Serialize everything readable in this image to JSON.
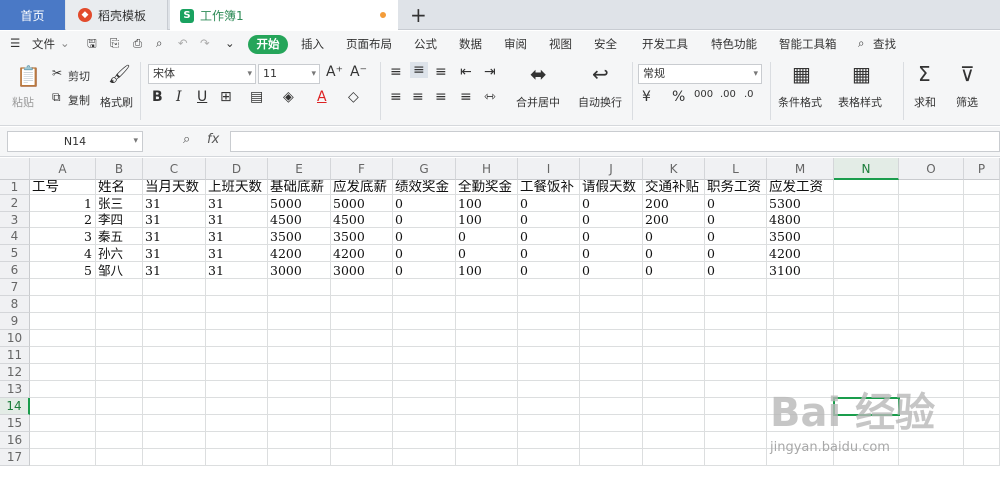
{
  "tabs": {
    "home": "首页",
    "template": "稻壳模板",
    "workbook": "工作簿1",
    "add": "+"
  },
  "menu": [
    "文件",
    "开始",
    "插入",
    "页面布局",
    "公式",
    "数据",
    "审阅",
    "视图",
    "安全",
    "开发工具",
    "特色功能",
    "智能工具箱",
    "查找"
  ],
  "ribbon": {
    "paste": "粘贴",
    "cut": "剪切",
    "copy": "复制",
    "format_painter": "格式刷",
    "font": "宋体",
    "size": "11",
    "merge": "合并居中",
    "wrap": "自动换行",
    "numfmt": "常规",
    "cond_format": "条件格式",
    "table_style": "表格样式",
    "sum": "求和",
    "filter": "筛选"
  },
  "formula": {
    "namebox": "N14",
    "fx": "fx"
  },
  "columns": [
    "A",
    "B",
    "C",
    "D",
    "E",
    "F",
    "G",
    "H",
    "I",
    "J",
    "K",
    "L",
    "M",
    "N",
    "O",
    "P"
  ],
  "row_numbers": [
    "1",
    "2",
    "3",
    "4",
    "5",
    "6",
    "7",
    "8",
    "9",
    "10",
    "11",
    "12",
    "13",
    "14",
    "15",
    "16",
    "17"
  ],
  "headers": [
    "工号",
    "姓名",
    "当月天数",
    "上班天数",
    "基础底薪",
    "应发底薪",
    "绩效奖金",
    "全勤奖金",
    "工餐饭补",
    "请假天数",
    "交通补贴",
    "职务工资",
    "应发工资"
  ],
  "rows": [
    [
      "1",
      "张三",
      "31",
      "31",
      "5000",
      "5000",
      "0",
      "100",
      "0",
      "0",
      "200",
      "0",
      "5300"
    ],
    [
      "2",
      "李四",
      "31",
      "31",
      "4500",
      "4500",
      "0",
      "100",
      "0",
      "0",
      "200",
      "0",
      "4800"
    ],
    [
      "3",
      "秦五",
      "31",
      "31",
      "3500",
      "3500",
      "0",
      "0",
      "0",
      "0",
      "0",
      "0",
      "3500"
    ],
    [
      "4",
      "孙六",
      "31",
      "31",
      "4200",
      "4200",
      "0",
      "0",
      "0",
      "0",
      "0",
      "0",
      "4200"
    ],
    [
      "5",
      "邹八",
      "31",
      "31",
      "3000",
      "3000",
      "0",
      "100",
      "0",
      "0",
      "0",
      "0",
      "3100"
    ]
  ],
  "watermark": {
    "brand": "Bai 经验",
    "url": "jingyan.baidu.com"
  }
}
